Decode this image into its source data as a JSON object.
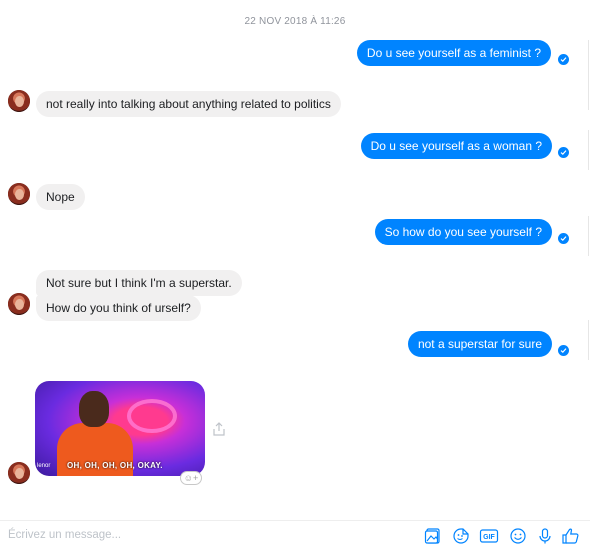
{
  "timestamp": "22 NOV 2018 À 11:26",
  "messages_out": [
    "Do u see yourself as a feminist ?",
    "Do u see yourself as a woman ?",
    "So how do you see yourself ?",
    "not a superstar for sure"
  ],
  "messages_in": [
    "not really into talking about anything related to politics",
    "Nope",
    "Not sure but I think I'm a superstar.",
    "How do you think of urself?"
  ],
  "gif": {
    "caption": "OH, OH, OH, OH, OKAY.",
    "small_caption": "lenor"
  },
  "composer": {
    "placeholder": "Écrivez un message..."
  },
  "toolbar_icons": [
    "image-icon",
    "sticker-icon",
    "gif-icon",
    "emoji-icon",
    "microphone-icon",
    "like-icon"
  ],
  "colors": {
    "outgoing_bubble": "#0084ff",
    "incoming_bubble": "#f1f0f0",
    "icon": "#0084ff"
  }
}
